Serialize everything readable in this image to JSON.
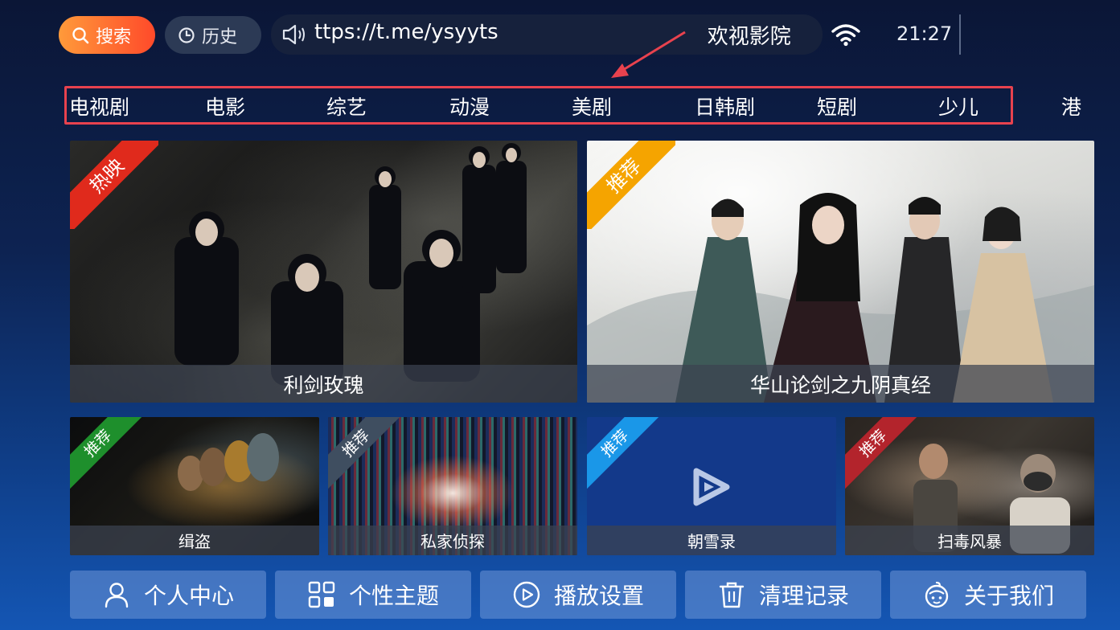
{
  "topbar": {
    "search_label": "搜索",
    "history_label": "历史",
    "marquee_text": "ttps://t.me/ysyyts",
    "marquee_text_2": "欢视影院",
    "clock": "21:27"
  },
  "nav": {
    "items": [
      "电视剧",
      "电影",
      "综艺",
      "动漫",
      "美剧",
      "日韩剧",
      "短剧",
      "少儿",
      "港"
    ]
  },
  "featured": [
    {
      "title": "利剑玫瑰",
      "badge": "热映",
      "badge_color": "#e02a1c"
    },
    {
      "title": "华山论剑之九阴真经",
      "badge": "推荐",
      "badge_color": "#f5a400"
    }
  ],
  "recommended": [
    {
      "title": "缉盗",
      "badge": "推荐",
      "badge_color": "#1e8f2c"
    },
    {
      "title": "私家侦探",
      "badge": "推荐",
      "badge_color": "#3f4e60"
    },
    {
      "title": "朝雪录",
      "badge": "推荐",
      "badge_color": "#1a97e8"
    },
    {
      "title": "扫毒风暴",
      "badge": "推荐",
      "badge_color": "#b3242c"
    }
  ],
  "menu": [
    {
      "label": "个人中心",
      "icon": "user-icon"
    },
    {
      "label": "个性主题",
      "icon": "theme-grid-icon"
    },
    {
      "label": "播放设置",
      "icon": "play-circle-icon"
    },
    {
      "label": "清理记录",
      "icon": "trash-icon"
    },
    {
      "label": "关于我们",
      "icon": "about-bot-icon"
    }
  ],
  "colors": {
    "accent": "#ff6a2f",
    "annotation": "#e8424e"
  }
}
